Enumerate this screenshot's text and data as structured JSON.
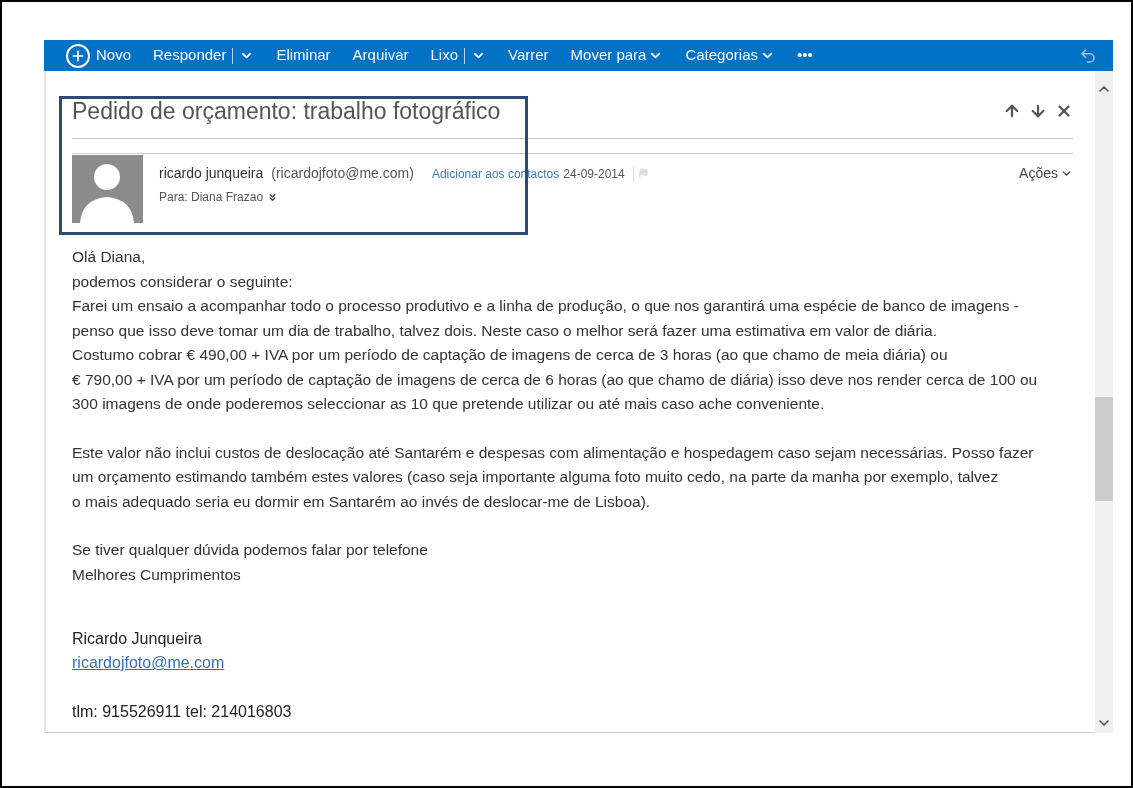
{
  "toolbar": {
    "items": [
      {
        "label": "Novo",
        "kind": "new"
      },
      {
        "label": "Responder",
        "kind": "split"
      },
      {
        "label": "Eliminar",
        "kind": "plain"
      },
      {
        "label": "Arquivar",
        "kind": "plain"
      },
      {
        "label": "Lixo",
        "kind": "split"
      },
      {
        "label": "Varrer",
        "kind": "plain"
      },
      {
        "label": "Mover para",
        "kind": "dropdown"
      },
      {
        "label": "Categorias",
        "kind": "dropdown"
      },
      {
        "label": "•••",
        "kind": "plain"
      }
    ]
  },
  "message": {
    "subject": "Pedido de orçamento: trabalho fotográfico",
    "sender_name": "ricardo junqueira",
    "sender_email": "(ricardojfoto@me.com)",
    "add_contact": "Adicionar aos contactos",
    "date": "24-09-2014",
    "to": "Para: Diana Frazao",
    "actions": "Ações",
    "body": [
      [
        "Olá Diana,",
        "podemos considerar o seguinte:",
        "Farei um ensaio a acompanhar todo o processo produtivo e a linha de produção, o que nos garantirá uma espécie de banco de imagens -",
        "penso que isso deve tomar um dia de trabalho, talvez dois. Neste caso o melhor será fazer uma estimativa em valor de diária.",
        "Costumo cobrar € 490,00 + IVA por um período de captação de imagens de cerca de 3 horas (ao que chamo de meia diária) ou",
        "€ 790,00 + IVA por um período de captação de imagens de cerca de 6 horas (ao que chamo de diária) isso deve nos render cerca de 100 ou",
        "300 imagens de onde poderemos seleccionar as 10 que pretende utilizar ou até mais caso ache conveniente."
      ],
      [
        "Este valor não inclui custos de deslocação até Santarém e despesas com alimentação e hospedagem caso sejam necessárias. Posso fazer",
        "um orçamento estimando também estes valores (caso seja importante alguma foto muito cedo, na parte da manha por exemplo, talvez",
        "o mais adequado seria eu dormir em Santarém ao invés de deslocar-me de Lisboa)."
      ],
      [
        "Se tiver qualquer dúvida podemos falar por telefone",
        "Melhores Cumprimentos"
      ]
    ],
    "signature": {
      "name": "Ricardo Junqueira",
      "email": "ricardojfoto@me.com",
      "phone": "tlm: 915526911 tel: 214016803"
    }
  }
}
